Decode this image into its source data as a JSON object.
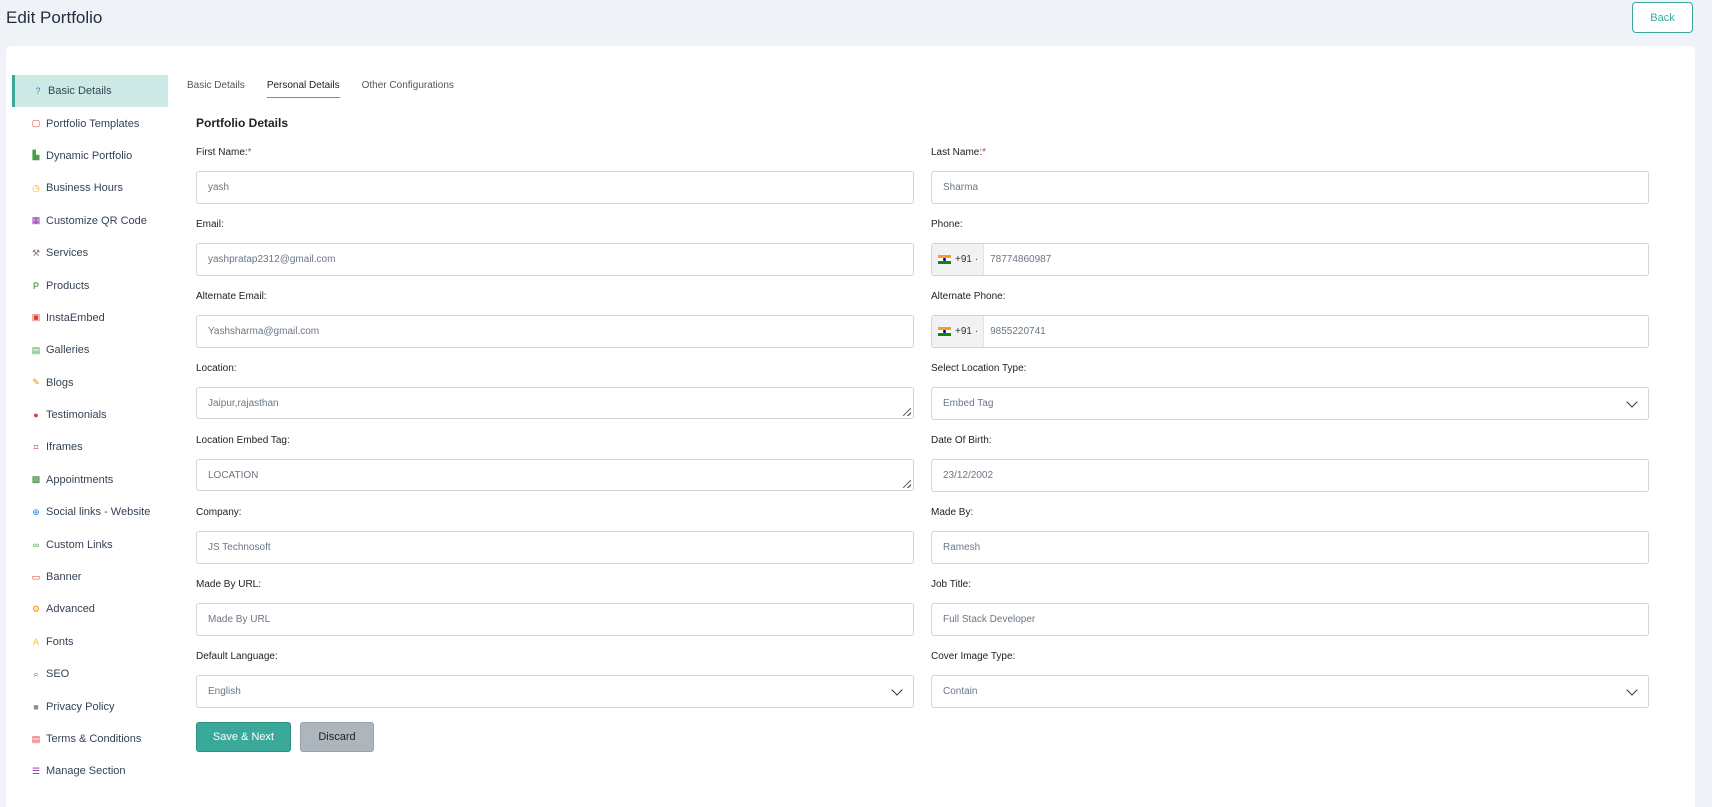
{
  "header": {
    "title": "Edit Portfolio",
    "back_label": "Back"
  },
  "sidebar": {
    "items": [
      {
        "label": "Basic Details",
        "icon": "help-circle-icon",
        "color": "#1e88e5",
        "glyph": "?"
      },
      {
        "label": "Portfolio Templates",
        "icon": "template-icon",
        "color": "#e53935",
        "glyph": "▢"
      },
      {
        "label": "Dynamic Portfolio",
        "icon": "chart-icon",
        "color": "#43a047",
        "glyph": "▙"
      },
      {
        "label": "Business Hours",
        "icon": "clock-icon",
        "color": "#f9a825",
        "glyph": "◷"
      },
      {
        "label": "Customize QR Code",
        "icon": "qr-code-icon",
        "color": "#8e24aa",
        "glyph": "▦"
      },
      {
        "label": "Services",
        "icon": "wrench-icon",
        "color": "#8d6e63",
        "glyph": "⚒"
      },
      {
        "label": "Products",
        "icon": "product-icon",
        "color": "#2e7d32",
        "glyph": "P"
      },
      {
        "label": "InstaEmbed",
        "icon": "instagram-icon",
        "color": "#e53935",
        "glyph": "▣"
      },
      {
        "label": "Galleries",
        "icon": "gallery-icon",
        "color": "#43a047",
        "glyph": "▤"
      },
      {
        "label": "Blogs",
        "icon": "blog-icon",
        "color": "#fb8c00",
        "glyph": "✎"
      },
      {
        "label": "Testimonials",
        "icon": "chat-bubble-icon",
        "color": "#e53935",
        "glyph": "●"
      },
      {
        "label": "Iframes",
        "icon": "crop-icon",
        "color": "#d81b60",
        "glyph": "⌗"
      },
      {
        "label": "Appointments",
        "icon": "calendar-icon",
        "color": "#2e7d32",
        "glyph": "▩"
      },
      {
        "label": "Social links - Website",
        "icon": "globe-icon",
        "color": "#1e88e5",
        "glyph": "⊕"
      },
      {
        "label": "Custom Links",
        "icon": "link-icon",
        "color": "#43a047",
        "glyph": "∞"
      },
      {
        "label": "Banner",
        "icon": "banner-icon",
        "color": "#e53935",
        "glyph": "▭"
      },
      {
        "label": "Advanced",
        "icon": "gears-icon",
        "color": "#fb8c00",
        "glyph": "⚙"
      },
      {
        "label": "Fonts",
        "icon": "font-icon",
        "color": "#fbc02d",
        "glyph": "A"
      },
      {
        "label": "SEO",
        "icon": "search-icon",
        "color": "#2e7d32",
        "glyph": "⌕"
      },
      {
        "label": "Privacy Policy",
        "icon": "lock-icon",
        "color": "#a1887f",
        "glyph": "■"
      },
      {
        "label": "Terms & Conditions",
        "icon": "document-icon",
        "color": "#e53935",
        "glyph": "▤"
      },
      {
        "label": "Manage Section",
        "icon": "list-icon",
        "color": "#8e24aa",
        "glyph": "☰"
      }
    ]
  },
  "tabs": [
    {
      "label": "Basic Details"
    },
    {
      "label": "Personal Details"
    },
    {
      "label": "Other Configurations"
    }
  ],
  "form": {
    "section_title": "Portfolio Details",
    "first_name": {
      "label": "First Name:",
      "required": "*",
      "value": "yash"
    },
    "last_name": {
      "label": "Last Name:",
      "required": "*",
      "value": "Sharma"
    },
    "email": {
      "label": "Email:",
      "value": "yashpratap2312@gmail.com"
    },
    "phone": {
      "label": "Phone:",
      "code": "+91",
      "value": "78774860987"
    },
    "alt_email": {
      "label": "Alternate Email:",
      "value": "Yashsharma@gmail.com"
    },
    "alt_phone": {
      "label": "Alternate Phone:",
      "code": "+91",
      "value": "9855220741"
    },
    "location": {
      "label": "Location:",
      "value": "Jaipur,rajasthan"
    },
    "location_type": {
      "label": "Select Location Type:",
      "value": "Embed Tag"
    },
    "location_embed": {
      "label": "Location Embed Tag:",
      "value": "LOCATION"
    },
    "dob": {
      "label": "Date Of Birth:",
      "value": "23/12/2002"
    },
    "company": {
      "label": "Company:",
      "value": "JS Technosoft"
    },
    "made_by": {
      "label": "Made By:",
      "value": "Ramesh"
    },
    "made_by_url": {
      "label": "Made By URL:",
      "placeholder": "Made By URL"
    },
    "job_title": {
      "label": "Job Title:",
      "value": "Full Stack Developer"
    },
    "default_language": {
      "label": "Default Language:",
      "value": "English"
    },
    "cover_image_type": {
      "label": "Cover Image Type:",
      "value": "Contain"
    },
    "save_label": "Save & Next",
    "discard_label": "Discard"
  },
  "colors": {
    "accent": "#3aa99a",
    "active_bg": "#cde9e6",
    "background": "#eff3f8"
  }
}
